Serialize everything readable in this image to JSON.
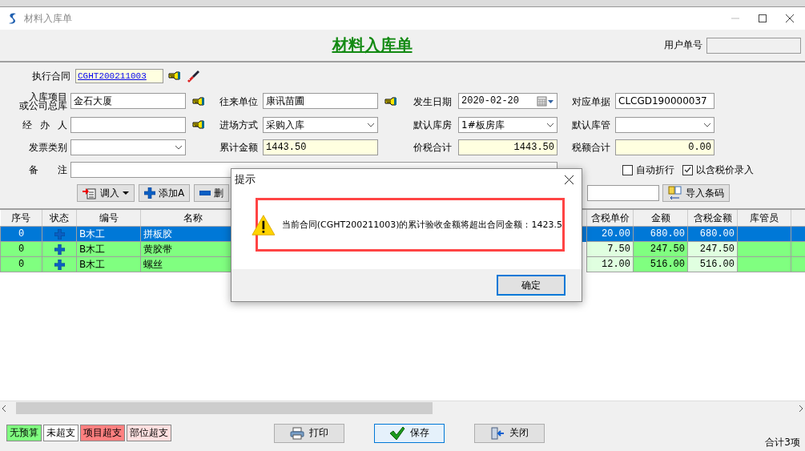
{
  "window": {
    "title": "材料入库单"
  },
  "header": {
    "title": "材料入库单",
    "user_no_label": "用户单号"
  },
  "contract": {
    "label": "执行合同",
    "value": "CGHT200211003"
  },
  "fields": [
    {
      "label_lines": [
        "入库项目",
        "或公司总库"
      ],
      "kind": "text",
      "value": "金石大厦",
      "picker": true
    },
    {
      "label": "往来单位",
      "kind": "text",
      "value": "康讯苗圃",
      "picker": true
    },
    {
      "label": "发生日期",
      "kind": "date",
      "value": "2020-02-20"
    },
    {
      "label": "对应单据",
      "kind": "text",
      "value": "CLCGD190000037"
    },
    {
      "label": "经 办 人",
      "kind": "text",
      "picker": true
    },
    {
      "label": "进场方式",
      "kind": "select",
      "value": "采购入库",
      "picker": false
    },
    {
      "label": "默认库房",
      "kind": "select",
      "value": "1#板房库"
    },
    {
      "label": "默认库管",
      "kind": "select"
    },
    {
      "label": "发票类别",
      "kind": "select",
      "picker": false
    },
    {
      "label": "累计金额",
      "kind": "readonly",
      "value": "1443.50",
      "picker": false
    },
    {
      "label": "价税合计",
      "kind": "readonly-right",
      "value": "1443.50"
    },
    {
      "label": "税额合计",
      "kind": "readonly-right",
      "value": "0.00"
    }
  ],
  "remark": {
    "label": "备 注"
  },
  "options": [
    {
      "label": "自动折行",
      "checked": false
    },
    {
      "label": "以含税价录入",
      "checked": true
    }
  ],
  "toolbar": [
    {
      "label": "调入",
      "dropdown": true
    },
    {
      "label": "添加A",
      "dropdown": false
    },
    {
      "label": "删",
      "dropdown": false
    }
  ],
  "barcode": {
    "button": "导入条码"
  },
  "table": {
    "columns": [
      {
        "label": "序号",
        "kind": "center",
        "editable": false
      },
      {
        "label": "状态",
        "kind": "status",
        "editable": false
      },
      {
        "label": "编号",
        "kind": "text",
        "editable": false
      },
      {
        "label": "名称",
        "kind": "text",
        "editable": false
      },
      {
        "label": "含税单价",
        "kind": "number",
        "editable": true
      },
      {
        "label": "金额",
        "kind": "number",
        "editable": false
      },
      {
        "label": "含税金额",
        "kind": "number",
        "editable": true
      },
      {
        "label": "库管员",
        "kind": "text",
        "editable": false
      }
    ],
    "rows": [
      {
        "selected": true,
        "cells": [
          "0",
          "",
          "B木工",
          "拼板胶",
          "20.00",
          "680.00",
          "680.00",
          ""
        ]
      },
      {
        "selected": false,
        "cells": [
          "0",
          "",
          "B木工",
          "黄胶带",
          "7.50",
          "247.50",
          "247.50",
          ""
        ]
      },
      {
        "selected": false,
        "cells": [
          "0",
          "",
          "B木工",
          "螺丝",
          "12.00",
          "516.00",
          "516.00",
          ""
        ]
      }
    ]
  },
  "legend": [
    {
      "label": "无预算",
      "color": "#80ff80"
    },
    {
      "label": "未超支",
      "color": "#ffffff"
    },
    {
      "label": "项目超支",
      "color": "#ff8080"
    },
    {
      "label": "部位超支",
      "color": "#ffe0e0"
    }
  ],
  "buttons": [
    {
      "label": "打印",
      "default": false
    },
    {
      "label": "保存",
      "default": true
    },
    {
      "label": "关闭",
      "default": false
    }
  ],
  "summary": "合计3项",
  "dialog": {
    "title": "提示",
    "message": "当前合同(CGHT200211003)的累计验收金额将超出合同金额：1423.5",
    "button": "确定"
  }
}
